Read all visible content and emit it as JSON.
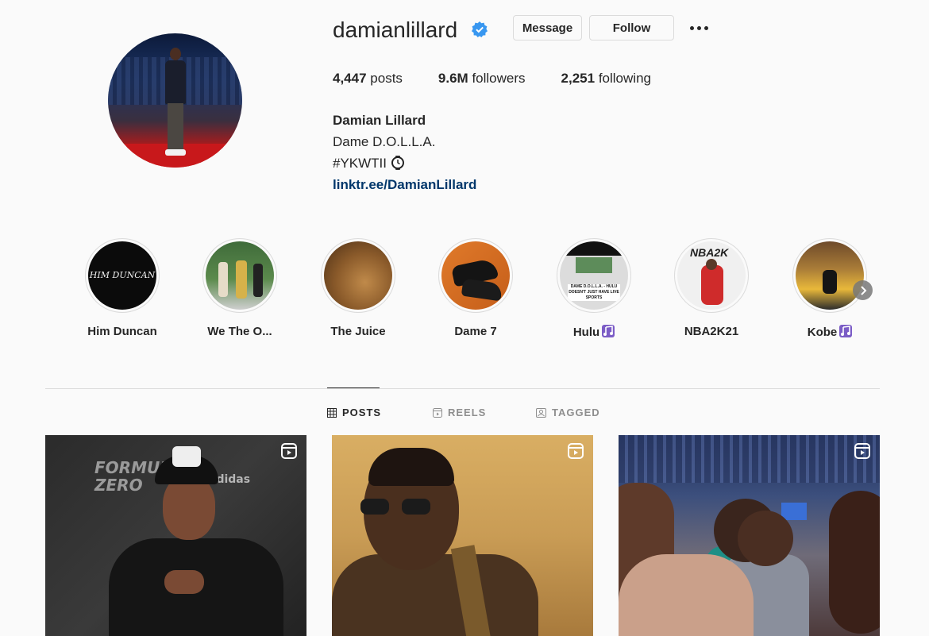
{
  "profile": {
    "username": "damianlillard",
    "message_label": "Message",
    "follow_label": "Follow",
    "stats": {
      "posts_count": "4,447",
      "posts_label": "posts",
      "followers_count": "9.6M",
      "followers_label": "followers",
      "following_count": "2,251",
      "following_label": "following"
    },
    "full_name": "Damian Lillard",
    "bio_line1": "Dame D.O.L.L.A.",
    "bio_line2": "#YKWTII",
    "link": "linktr.ee/DamianLillard"
  },
  "highlights": [
    {
      "label": "Him Duncan",
      "icon": null
    },
    {
      "label": "We The O...",
      "icon": null
    },
    {
      "label": "The Juice",
      "icon": null
    },
    {
      "label": "Dame 7",
      "icon": null
    },
    {
      "label": "Hulu",
      "icon": "music-notes-icon"
    },
    {
      "label": "NBA2K21",
      "icon": null
    },
    {
      "label": "Kobe",
      "icon": "music-notes-icon"
    }
  ],
  "highlight_texts": {
    "him_duncan_art": "HIM DUNCAN",
    "hulu_art": "DAME D.O.L.L.A. - HULU DOESN'T JUST HAVE LIVE SPORTS",
    "nba_art": "NBA2K"
  },
  "tabs": {
    "posts": "POSTS",
    "reels": "REELS",
    "tagged": "TAGGED"
  },
  "posts": {
    "post1_text": "FORMULA ZERO",
    "post1_brand": "adidas"
  },
  "colors": {
    "link": "#00376b",
    "verified": "#3897f0",
    "text": "#262626",
    "muted": "#8e8e8e"
  }
}
